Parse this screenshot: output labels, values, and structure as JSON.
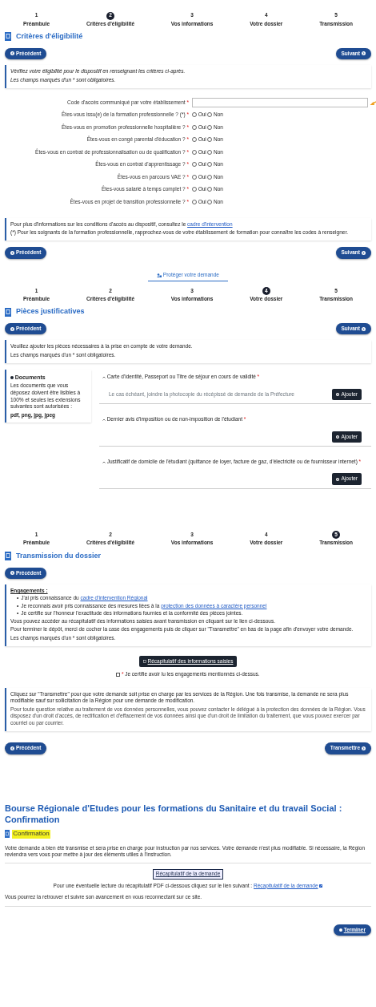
{
  "eligibility": {
    "steps": [
      {
        "number": "1",
        "label": "Préambule",
        "selected": false
      },
      {
        "number": "2",
        "label": "Critères d'éligibilité",
        "selected": true
      },
      {
        "number": "3",
        "label": "Vos informations",
        "selected": false
      },
      {
        "number": "4",
        "label": "Votre dossier",
        "selected": false
      },
      {
        "number": "5",
        "label": "Transmission",
        "selected": false
      }
    ],
    "heading": "Critères d'éligibilité",
    "nav_top": {
      "previous": "Précédent",
      "next": "Suivant"
    },
    "info": [
      "Vérifiez votre éligibilité pour le dispositif en renseignant les critères ci-après.",
      "Les champs marqués d'un * sont obligatoires."
    ],
    "fields": [
      {
        "kind": "text",
        "label": "Code d'accès communiqué par votre établissement",
        "mark": "*"
      },
      {
        "kind": "radio",
        "label": "Êtes-vous issu(e) de la formation professionnelle ? (*)",
        "mark": "*",
        "options": [
          {
            "label": "Oui",
            "selected": false
          },
          {
            "label": "Non",
            "selected": false
          }
        ]
      },
      {
        "kind": "radio",
        "label": "Êtes-vous en promotion professionnelle hospitalière ?",
        "mark": "*",
        "options": [
          {
            "label": "Oui",
            "selected": false
          },
          {
            "label": "Non",
            "selected": false
          }
        ]
      },
      {
        "kind": "radio",
        "label": "Êtes-vous en congé parental d'éducation ?",
        "mark": "*",
        "options": [
          {
            "label": "Oui",
            "selected": false
          },
          {
            "label": "Non",
            "selected": false
          }
        ]
      },
      {
        "kind": "radio",
        "label": "Êtes-vous en contrat de professionnalisation ou de qualification ?",
        "mark": "*",
        "options": [
          {
            "label": "Oui",
            "selected": false
          },
          {
            "label": "Non",
            "selected": false
          }
        ]
      },
      {
        "kind": "radio",
        "label": "Êtes-vous en contrat d'apprentissage ?",
        "mark": "*",
        "options": [
          {
            "label": "Oui",
            "selected": false
          },
          {
            "label": "Non",
            "selected": false
          }
        ]
      },
      {
        "kind": "radio",
        "label": "Êtes-vous en parcours VAE ?",
        "mark": "*",
        "options": [
          {
            "label": "Oui",
            "selected": false
          },
          {
            "label": "Non",
            "selected": false
          }
        ]
      },
      {
        "kind": "radio",
        "label": "Êtes-vous salarié à temps complet ?",
        "mark": "*",
        "options": [
          {
            "label": "Oui",
            "selected": false
          },
          {
            "label": "Non",
            "selected": false
          }
        ]
      },
      {
        "kind": "radio",
        "label": "Êtes-vous en projet de transition professionnelle ?",
        "mark": "*",
        "options": [
          {
            "label": "Oui",
            "selected": false
          },
          {
            "label": "Non",
            "selected": false
          }
        ]
      }
    ],
    "note": {
      "text": "Pour plus d'informations sur les conditions d'accès au dispositif, consultez le",
      "link": "cadre d'intervention",
      "footnote": "(*) Pour les soignants de la formation professionnelle, rapprochez-vous de votre établissement de formation pour connaître les codes à renseigner."
    },
    "nav_bottom": {
      "previous": "Précédent",
      "next": "Suivant"
    }
  },
  "documents": {
    "tab": "Protéger votre demande",
    "steps": [
      {
        "number": "1",
        "label": "Préambule",
        "selected": false
      },
      {
        "number": "2",
        "label": "Critères d'éligibilité",
        "selected": false
      },
      {
        "number": "3",
        "label": "Vos informations",
        "selected": false
      },
      {
        "number": "4",
        "label": "Votre dossier",
        "selected": true
      },
      {
        "number": "5",
        "label": "Transmission",
        "selected": false
      }
    ],
    "heading": "Pièces justificatives",
    "nav_top": {
      "previous": "Précédent",
      "next": "Suivant"
    },
    "info": [
      "Veuillez ajouter les pièces nécessaires à la prise en compte de votre demande.",
      "Les champs marqués d'un * sont obligatoires."
    ],
    "sidebar": {
      "title": "Documents",
      "text": "Les documents que vous déposez doivent être lisibles à 100% et seules les extensions suivantes sont autorisées :",
      "extensions": "pdf, png, jpg, jpeg"
    },
    "items": [
      {
        "title": "Carte d'identité, Passeport ou Titre de séjour en cours de validité",
        "mark": "*",
        "hint": "Le cas échéant, joindre la photocopie du récépissé de demande de la Préfecture",
        "button": "Ajouter"
      },
      {
        "title": "Dernier avis d'imposition ou de non-imposition de l'étudiant",
        "mark": "*",
        "button": "Ajouter"
      },
      {
        "title": "Justificatif de domicile de l'étudiant (quittance de loyer, facture de gaz, d'électricité ou de fournisseur internet)",
        "mark": "*",
        "button": "Ajouter"
      }
    ]
  },
  "transmission": {
    "steps": [
      {
        "number": "1",
        "label": "Préambule",
        "selected": false
      },
      {
        "number": "2",
        "label": "Critères d'éligibilité",
        "selected": false
      },
      {
        "number": "3",
        "label": "Vos informations",
        "selected": false
      },
      {
        "number": "4",
        "label": "Votre dossier",
        "selected": false
      },
      {
        "number": "5",
        "label": "Transmission",
        "selected": true
      }
    ],
    "heading": "Transmission du dossier",
    "previous_top": "Précédent",
    "engagements": {
      "title": "Engagements :",
      "items": [
        {
          "bullet": "•",
          "text": "J'ai pris connaissance du",
          "link": "cadre d'intervention Régional"
        },
        {
          "bullet": "•",
          "text": "Je reconnais avoir pris connaissance des mesures liées à la",
          "link": "protection des données à caractère personnel"
        },
        {
          "bullet": "•",
          "text": "Je certifie sur l'honneur l'exactitude des informations fournies et la conformité des pièces jointes."
        }
      ],
      "paragraphs": [
        "Vous pouvez accéder au récapitulatif des informations saisies avant transmission en cliquant sur le lien ci-dessous.",
        "Pour terminer le dépôt, merci de cocher la case des engagements puis de cliquer sur \"Transmettre\" en bas de la page afin d'envoyer votre demande.",
        "Les champs marqués d'un * sont obligatoires."
      ]
    },
    "summary_button": "Récapitulatif des informations saisies",
    "checkbox": {
      "mark": "*",
      "label": "Je certifie avoir lu les engagements mentionnés ci-dessus.",
      "checked": false
    },
    "notice": {
      "text": "Cliquez sur \"Transmettre\" pour que votre demande soit prise en charge par les services de la Région. Une fois transmise, la demande ne sera plus modifiable sauf sur sollicitation de la Région pour une demande de modification.",
      "small": "Pour toute question relative au traitement de vos données personnelles, vous pouvez contacter le délégué à la protection des données de la Région. Vous disposez d'un droit d'accès, de rectification et d'effacement de vos données ainsi que d'un droit de limitation du traitement, que vous pouvez exercer par courriel ou par courrier."
    },
    "nav_bottom": {
      "previous": "Précédent",
      "next": "Transmettre"
    }
  },
  "confirmation": {
    "title": "Bourse Régionale d'Etudes pour les formations du Sanitaire et du travail Social : Confirmation",
    "heading": "Confirmation",
    "text": "Votre demande a bien été transmise et sera prise en charge pour instruction par nos services. Votre demande n'est plus modifiable. Si nécessaire, la Région reviendra vers vous pour mettre à jour des éléments utiles à l'instruction.",
    "summary_link": "Récapitulatif de la demande",
    "pdf_line": {
      "text": "Pour une éventuelle lecture du récapitulatif PDF ci-dessous cliquez sur le lien suivant :",
      "link": "Récapitulatif de la demande"
    },
    "follow_up": "Vous pourrez la retrouver et suivre son avancement en vous reconnectant sur ce site.",
    "finish": "Terminer"
  }
}
